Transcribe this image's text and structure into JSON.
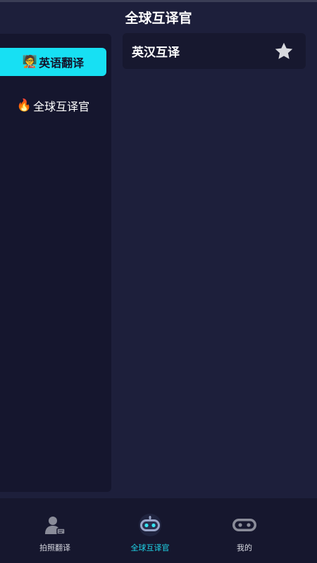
{
  "header": {
    "title": "全球互译官"
  },
  "sidebar": {
    "items": [
      {
        "emoji": "🧑‍🏫",
        "label": "英语翻译",
        "active": true
      },
      {
        "emoji": "🔥",
        "label": "全球互译官",
        "active": false
      }
    ]
  },
  "content": {
    "cards": [
      {
        "title": "英汉互译",
        "icon": "star-icon"
      }
    ]
  },
  "tabbar": {
    "tabs": [
      {
        "label": "拍照翻译",
        "icon": "photo-translate-icon",
        "active": false
      },
      {
        "label": "全球互译官",
        "icon": "robot-icon",
        "active": true
      },
      {
        "label": "我的",
        "icon": "profile-icon",
        "active": false
      }
    ]
  },
  "colors": {
    "background": "#1d1f3b",
    "sidebar": "#15162e",
    "accent": "#17e0f3",
    "card": "#17182f",
    "tabbar": "#16172e"
  }
}
